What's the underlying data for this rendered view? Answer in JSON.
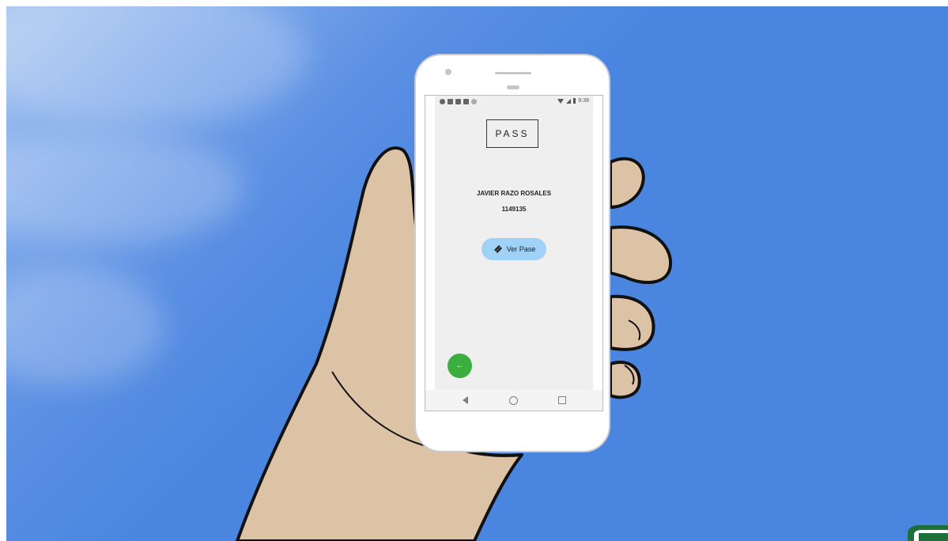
{
  "phone": {
    "status_time": "9:38",
    "app_logo_text": "PASS",
    "user_name": "JAVIER RAZO ROSALES",
    "user_id": "1149135",
    "view_pass_label": "Ver Pase",
    "view_pass_icon": "ticket-icon",
    "back_icon": "arrow-left-icon",
    "nav_icons": [
      "back-triangle-icon",
      "home-circle-icon",
      "recents-square-icon"
    ]
  },
  "colors": {
    "sky": "#4a86e0",
    "skin": "#ddc3a6",
    "pass_button": "#9fd2f6",
    "fab": "#3cae3f",
    "corner_logo": "#1f6f3a"
  }
}
